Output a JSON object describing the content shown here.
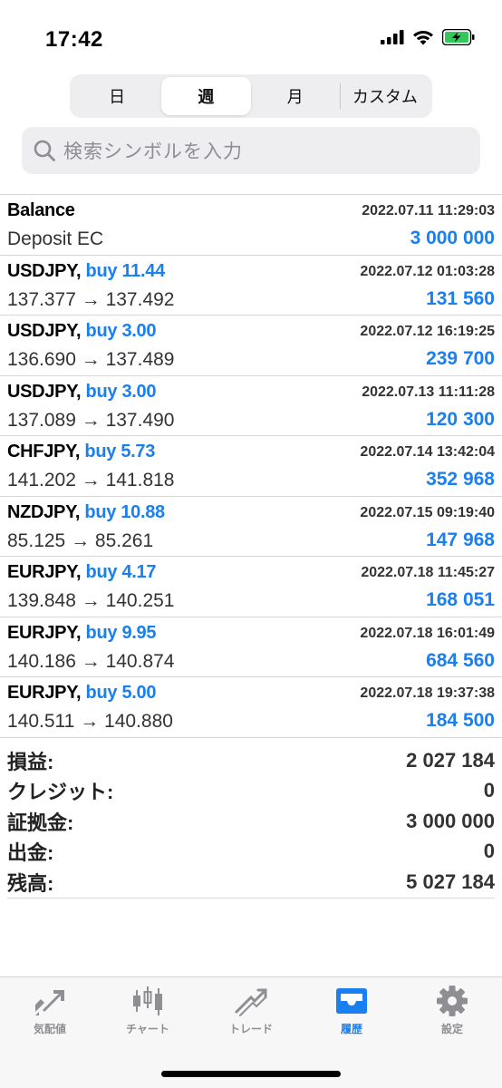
{
  "status": {
    "time": "17:42"
  },
  "period_tabs": [
    {
      "label": "日",
      "active": false
    },
    {
      "label": "週",
      "active": true
    },
    {
      "label": "月",
      "active": false
    },
    {
      "label": "カスタム",
      "active": false
    }
  ],
  "search": {
    "placeholder": "検索シンボルを入力"
  },
  "history": [
    {
      "symbol": "Balance",
      "side": "",
      "detail": "Deposit EC",
      "date": "2022.07.11 11:29:03",
      "amount": "3 000 000"
    },
    {
      "symbol": "USDJPY,",
      "side": "buy 11.44",
      "detail": "137.377 → 137.492",
      "date": "2022.07.12 01:03:28",
      "amount": "131 560"
    },
    {
      "symbol": "USDJPY,",
      "side": "buy 3.00",
      "detail": "136.690 → 137.489",
      "date": "2022.07.12 16:19:25",
      "amount": "239 700"
    },
    {
      "symbol": "USDJPY,",
      "side": "buy 3.00",
      "detail": "137.089 → 137.490",
      "date": "2022.07.13 11:11:28",
      "amount": "120 300"
    },
    {
      "symbol": "CHFJPY,",
      "side": "buy 5.73",
      "detail": "141.202 → 141.818",
      "date": "2022.07.14 13:42:04",
      "amount": "352 968"
    },
    {
      "symbol": "NZDJPY,",
      "side": "buy 10.88",
      "detail": "85.125 → 85.261",
      "date": "2022.07.15 09:19:40",
      "amount": "147 968"
    },
    {
      "symbol": "EURJPY,",
      "side": "buy 4.17",
      "detail": "139.848 → 140.251",
      "date": "2022.07.18 11:45:27",
      "amount": "168 051"
    },
    {
      "symbol": "EURJPY,",
      "side": "buy 9.95",
      "detail": "140.186 → 140.874",
      "date": "2022.07.18 16:01:49",
      "amount": "684 560"
    },
    {
      "symbol": "EURJPY,",
      "side": "buy 5.00",
      "detail": "140.511 → 140.880",
      "date": "2022.07.18 19:37:38",
      "amount": "184 500"
    }
  ],
  "summary": [
    {
      "label": "損益:",
      "value": "2 027 184"
    },
    {
      "label": "クレジット:",
      "value": "0"
    },
    {
      "label": "証拠金:",
      "value": "3 000 000"
    },
    {
      "label": "出金:",
      "value": "0"
    },
    {
      "label": "残高:",
      "value": "5 027 184"
    }
  ],
  "tabbar": [
    {
      "label": "気配値",
      "icon": "quotes-icon",
      "active": false
    },
    {
      "label": "チャート",
      "icon": "chart-icon",
      "active": false
    },
    {
      "label": "トレード",
      "icon": "trade-icon",
      "active": false
    },
    {
      "label": "履歴",
      "icon": "history-icon",
      "active": true
    },
    {
      "label": "設定",
      "icon": "settings-icon",
      "active": false
    }
  ],
  "colors": {
    "accent": "#1a7ff0",
    "inactive": "#8e8e93",
    "battery": "#34c759"
  }
}
